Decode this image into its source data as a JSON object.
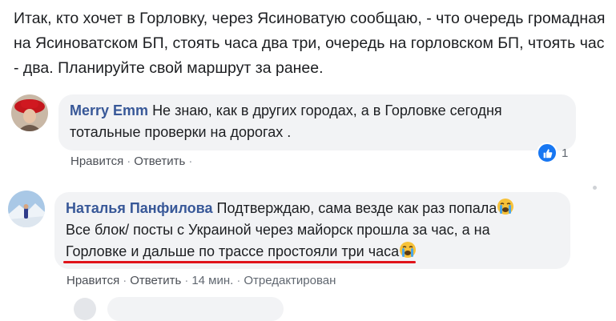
{
  "post": {
    "text": "Итак, кто хочет в Горловку, через Ясиноватую сообщаю, - что очередь громадная на Ясиноватском БП, стоять часа два три, очередь на горловском БП, чтоять час - два. Планируйте свой маршрут за ранее."
  },
  "comments": [
    {
      "author": "Merry Emm",
      "text": "Не знаю, как в других городах, а в Горловке сегодня тотальные проверки на дорогах .",
      "like_label": "Нравится",
      "reply_label": "Ответить",
      "reaction_count": "1"
    },
    {
      "author": "Наталья Панфилова",
      "text_line1": "Подтверждаю, сама везде как раз попала",
      "text_line2": "Все блок/ посты с Украиной через майорск прошла за час, а на",
      "text_line3": "Горловке и дальше по трассе простояли три часа",
      "like_label": "Нравится",
      "reply_label": "Ответить",
      "time": "14 мин.",
      "edited_label": "Отредактирован"
    }
  ],
  "colors": {
    "author": "#385898",
    "bubble": "#f2f3f5",
    "underline": "#e0141b",
    "like": "#1877f2"
  },
  "icons": {
    "reaction": "like-thumb-icon",
    "emoji": "crying-face-emoji-icon"
  }
}
